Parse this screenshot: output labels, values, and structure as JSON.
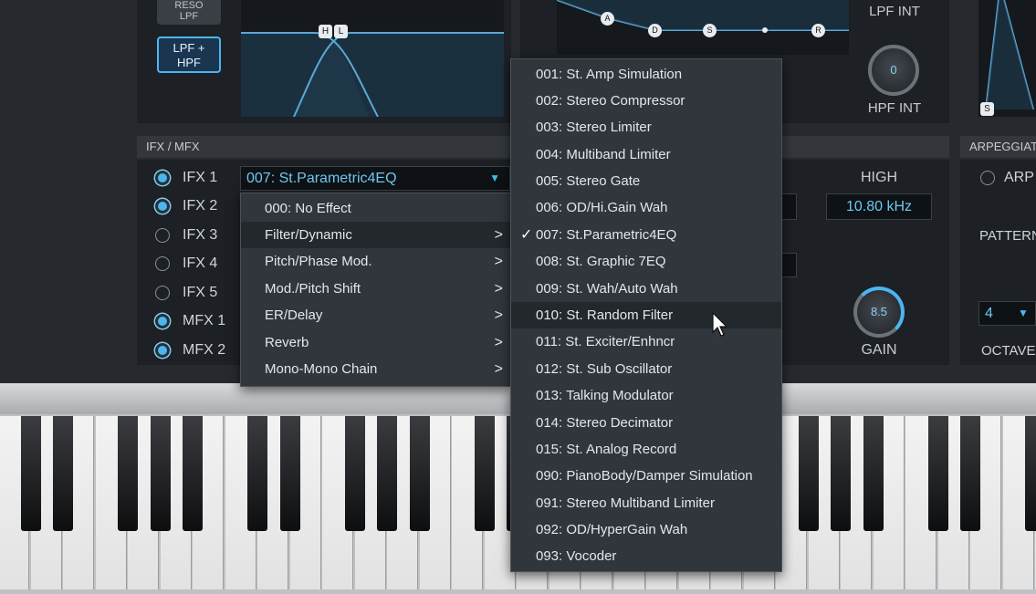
{
  "filter": {
    "reso_lpf_label": "RESO\nLPF",
    "lpf_hpf_label": "LPF +\nHPF",
    "markers": [
      "H",
      "L"
    ]
  },
  "envelope": {
    "markers": [
      "A",
      "D",
      "S",
      "R"
    ]
  },
  "lpf_int_label": "LPF INT",
  "hpf_int_knob_value": "0",
  "hpf_int_label": "HPF INT",
  "right_env_marker": "S",
  "ifx_section": {
    "title": "IFX / MFX",
    "slots": [
      {
        "label": "IFX 1",
        "on": true
      },
      {
        "label": "IFX 2",
        "on": true
      },
      {
        "label": "IFX 3",
        "on": false
      },
      {
        "label": "IFX 4",
        "on": false
      },
      {
        "label": "IFX 5",
        "on": false
      },
      {
        "label": "MFX 1",
        "on": true
      },
      {
        "label": "MFX 2",
        "on": true
      }
    ],
    "selected_effect": "007: St.Parametric4EQ",
    "dropdown_arrow": "▼"
  },
  "eq": {
    "high_label": "HIGH",
    "high_value": "10.80 kHz",
    "gain_value": "8.5",
    "gain_label": "GAIN"
  },
  "arpeggiator": {
    "title": "ARPEGGIAT",
    "arp_label": "ARP C",
    "pattern_label": "PATTERN",
    "octave_value": "4",
    "octave_arrow": "▼",
    "octave_label": "OCTAVE"
  },
  "category_menu": {
    "items": [
      {
        "label": "000: No Effect",
        "submenu": false
      },
      {
        "label": "Filter/Dynamic",
        "submenu": true,
        "highlighted": true
      },
      {
        "label": "Pitch/Phase Mod.",
        "submenu": true
      },
      {
        "label": "Mod./Pitch Shift",
        "submenu": true
      },
      {
        "label": "ER/Delay",
        "submenu": true
      },
      {
        "label": "Reverb",
        "submenu": true
      },
      {
        "label": "Mono-Mono Chain",
        "submenu": true
      }
    ],
    "chevron": ">"
  },
  "effect_submenu": {
    "check_mark": "✓",
    "items": [
      {
        "label": "001: St. Amp Simulation"
      },
      {
        "label": "002: Stereo Compressor"
      },
      {
        "label": "003: Stereo Limiter"
      },
      {
        "label": "004: Multiband Limiter"
      },
      {
        "label": "005: Stereo Gate"
      },
      {
        "label": "006: OD/Hi.Gain Wah"
      },
      {
        "label": "007: St.Parametric4EQ",
        "checked": true
      },
      {
        "label": "008: St. Graphic 7EQ"
      },
      {
        "label": "009: St. Wah/Auto Wah"
      },
      {
        "label": "010: St. Random Filter",
        "highlighted": true
      },
      {
        "label": "011: St. Exciter/Enhncr"
      },
      {
        "label": "012: St. Sub Oscillator"
      },
      {
        "label": "013: Talking Modulator"
      },
      {
        "label": "014: Stereo Decimator"
      },
      {
        "label": "015: St. Analog Record"
      },
      {
        "label": "090: PianoBody/Damper Simulation"
      },
      {
        "label": "091: Stereo Multiband Limiter"
      },
      {
        "label": "092: OD/HyperGain Wah"
      },
      {
        "label": "093: Vocoder"
      }
    ]
  }
}
